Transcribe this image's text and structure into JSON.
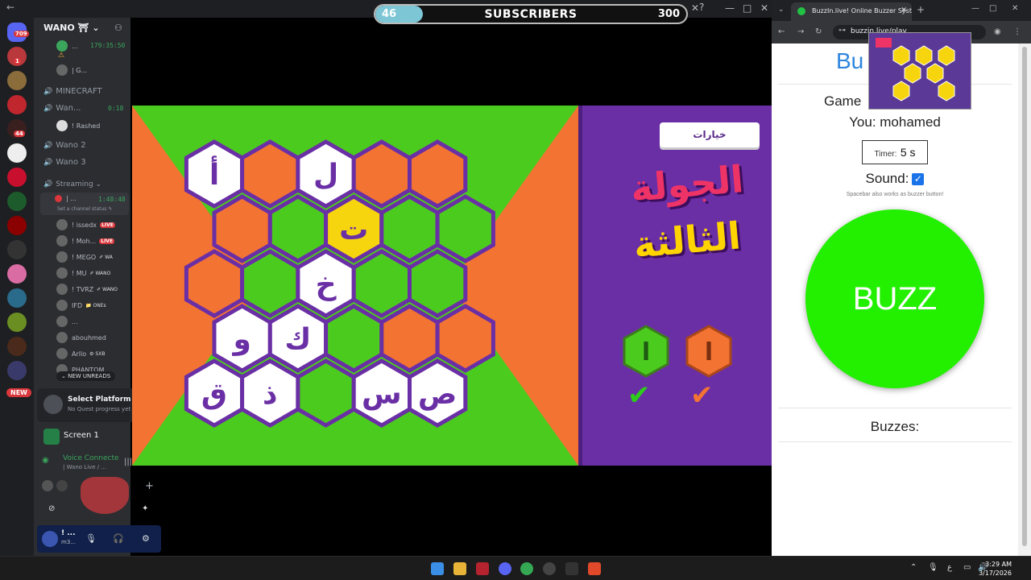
{
  "subscribers": {
    "current": "46",
    "label": "SUBSCRIBERS",
    "goal": "300",
    "progress_fraction": 0.153
  },
  "discord": {
    "server_name": "WANO ⛩ ⌄",
    "rail_badges": [
      "709",
      "1",
      "44"
    ],
    "new_pill": "NEW",
    "channels": {
      "top_time": "179:35:50",
      "warning": "⚠",
      "top_user": "| G...",
      "minecraft": "MINECRAFT",
      "wano1": "Wan...",
      "wano1_time": "0:18",
      "rashed": "! Rashed",
      "wano2": "Wano 2",
      "wano3": "Wano 3",
      "streaming": "Streaming ⌄",
      "streaming_user": "| ...",
      "streaming_time": "1:48:48",
      "set_status": "Set a channel status ✎"
    },
    "stream_users": [
      {
        "name": "! issedx",
        "tag": "LIVE"
      },
      {
        "name": "! Moh...",
        "tag": "LIVE"
      },
      {
        "name": "! MEGO",
        "tag": "✐ WA"
      },
      {
        "name": "! MU",
        "tag": "✐ WANO"
      },
      {
        "name": "! TVRZ",
        "tag": "✐ WANO"
      },
      {
        "name": "IFD",
        "tag": "📁 ONEs"
      },
      {
        "name": "...",
        "tag": ""
      },
      {
        "name": "abouhmed",
        "tag": ""
      },
      {
        "name": "Arllo",
        "tag": "⚙ SXB"
      },
      {
        "name": "PHANTOM",
        "tag": ""
      }
    ],
    "new_unreads": "⌄ NEW UNREADS",
    "quest": {
      "title": "Select Platform",
      "sub": "No Quest progress yet"
    },
    "screen": "Screen 1",
    "voice": {
      "title": "Voice Connecte",
      "sub": "| Wano Live / ..."
    },
    "user_short": "! ...",
    "user_sub": "m3..."
  },
  "game": {
    "options_button": "خيارات",
    "round_line1": "الجولة",
    "round_line2": "الثالثة",
    "cells": [
      {
        "r": 0,
        "c": 0,
        "color": "white",
        "letter": "أ"
      },
      {
        "r": 0,
        "c": 1,
        "color": "orange",
        "letter": ""
      },
      {
        "r": 0,
        "c": 2,
        "color": "white",
        "letter": "ل"
      },
      {
        "r": 0,
        "c": 3,
        "color": "orange",
        "letter": ""
      },
      {
        "r": 0,
        "c": 4,
        "color": "orange",
        "letter": ""
      },
      {
        "r": 1,
        "c": 0,
        "color": "orange",
        "letter": ""
      },
      {
        "r": 1,
        "c": 1,
        "color": "green",
        "letter": ""
      },
      {
        "r": 1,
        "c": 2,
        "color": "yellow",
        "letter": "ت"
      },
      {
        "r": 1,
        "c": 3,
        "color": "green",
        "letter": ""
      },
      {
        "r": 1,
        "c": 4,
        "color": "green",
        "letter": ""
      },
      {
        "r": 2,
        "c": 0,
        "color": "orange",
        "letter": ""
      },
      {
        "r": 2,
        "c": 1,
        "color": "green",
        "letter": ""
      },
      {
        "r": 2,
        "c": 2,
        "color": "white",
        "letter": "خ"
      },
      {
        "r": 2,
        "c": 3,
        "color": "green",
        "letter": ""
      },
      {
        "r": 2,
        "c": 4,
        "color": "green",
        "letter": ""
      },
      {
        "r": 3,
        "c": 0,
        "color": "white",
        "letter": "و"
      },
      {
        "r": 3,
        "c": 1,
        "color": "white",
        "letter": "ك"
      },
      {
        "r": 3,
        "c": 2,
        "color": "green",
        "letter": ""
      },
      {
        "r": 3,
        "c": 3,
        "color": "orange",
        "letter": ""
      },
      {
        "r": 3,
        "c": 4,
        "color": "orange",
        "letter": ""
      },
      {
        "r": 4,
        "c": 0,
        "color": "white",
        "letter": "ق"
      },
      {
        "r": 4,
        "c": 1,
        "color": "white",
        "letter": "ذ"
      },
      {
        "r": 4,
        "c": 2,
        "color": "green",
        "letter": ""
      },
      {
        "r": 4,
        "c": 3,
        "color": "white",
        "letter": "س"
      },
      {
        "r": 4,
        "c": 4,
        "color": "white",
        "letter": "ص"
      }
    ],
    "colors": {
      "green": "#4ccb1f",
      "orange": "#f37332",
      "purple": "#6a2fa5",
      "yellow": "#f6d50f",
      "white": "#ffffff",
      "border": "#6a2fa5"
    },
    "team_green_char": "ا",
    "team_orange_char": "ا",
    "check_char": "✔"
  },
  "browser": {
    "tab_title": "BuzzIn.live! Online Buzzer Syste",
    "url": "buzzin.live/play",
    "app_title": "Bu",
    "game_label": "Game",
    "you_label": "You: mohamed",
    "timer_label": "Timer:",
    "timer_value": "5 s",
    "sound_label": "Sound:",
    "hint": "Spacebar also works as buzzer button!",
    "buzz_button": "BUZZ",
    "buzzes_label": "Buzzes:"
  },
  "taskbar": {
    "time": "3:29 AM",
    "date": "3/17/2026",
    "lang": "ع"
  }
}
